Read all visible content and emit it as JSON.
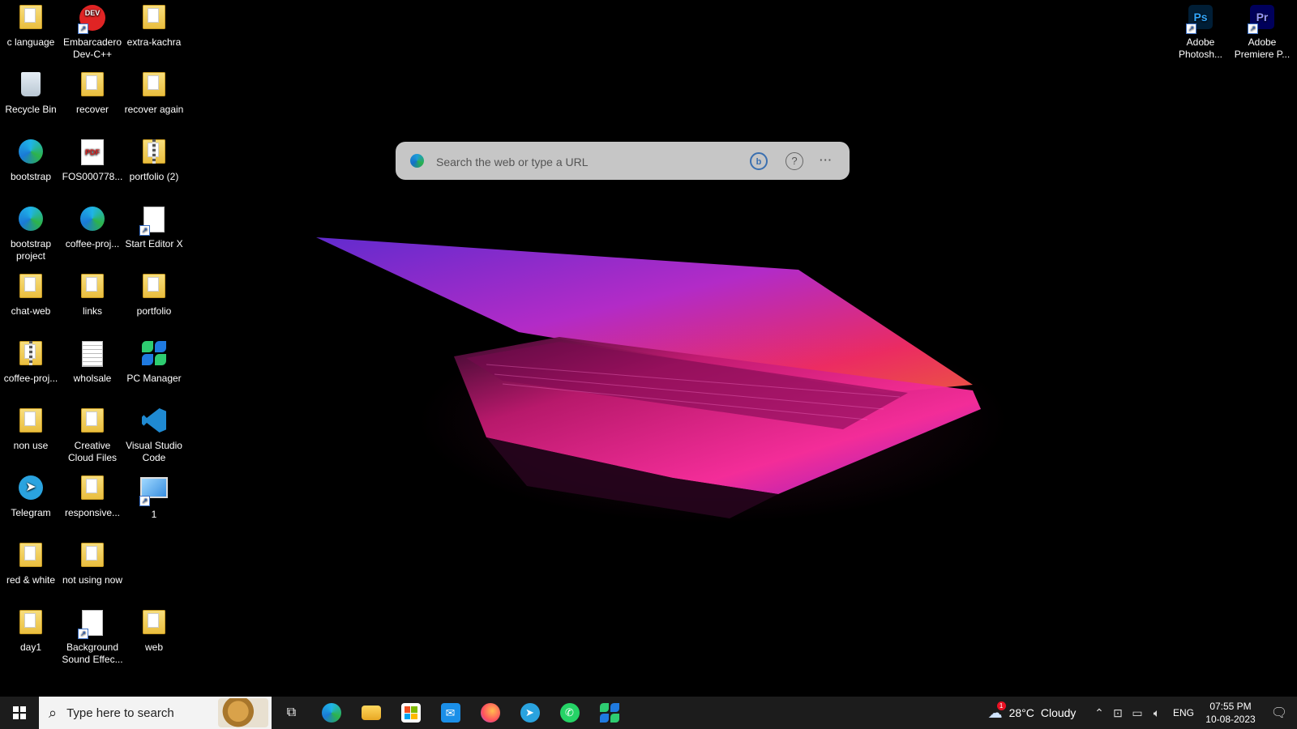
{
  "desktop_icons": [
    {
      "label": "c language"
    },
    {
      "label": "Embarcadero Dev-C++",
      "badge": "DEV"
    },
    {
      "label": "extra-kachra"
    },
    {
      "label": "Recycle Bin"
    },
    {
      "label": "recover"
    },
    {
      "label": "recover again"
    },
    {
      "label": "bootstrap"
    },
    {
      "label": "FOS000778...",
      "badge": "PDF"
    },
    {
      "label": "portfolio (2)"
    },
    {
      "label": "bootstrap project"
    },
    {
      "label": "coffee-proj..."
    },
    {
      "label": "Start Editor X"
    },
    {
      "label": "chat-web"
    },
    {
      "label": "links"
    },
    {
      "label": "portfolio"
    },
    {
      "label": "coffee-proj..."
    },
    {
      "label": "wholsale"
    },
    {
      "label": "PC Manager"
    },
    {
      "label": "non use"
    },
    {
      "label": "Creative Cloud Files"
    },
    {
      "label": "Visual Studio Code"
    },
    {
      "label": "Telegram"
    },
    {
      "label": "responsive..."
    },
    {
      "label": "1"
    },
    {
      "label": "red & white"
    },
    {
      "label": "not using now"
    },
    {
      "label": "day1"
    },
    {
      "label": "Background Sound Effec..."
    },
    {
      "label": "web"
    },
    {
      "label": "Adobe Photosh...",
      "badge": "Ps"
    },
    {
      "label": "Adobe Premiere P...",
      "badge": "Pr"
    }
  ],
  "search_widget": {
    "placeholder": "Search the web or type a URL",
    "bing_icon": "bing-chat-icon",
    "help_icon": "help-icon",
    "more_icon": "more-icon"
  },
  "taskbar": {
    "search_placeholder": "Type here to search",
    "apps": [
      "task-view-icon",
      "edge-icon",
      "file-explorer-icon",
      "store-icon",
      "mail-icon",
      "firefox-icon",
      "telegram-icon",
      "whatsapp-icon",
      "pc-manager-icon"
    ],
    "weather": {
      "temp": "28°C",
      "condition": "Cloudy",
      "badge": "1"
    },
    "language": "ENG",
    "time": "07:55 PM",
    "date": "10-08-2023"
  }
}
